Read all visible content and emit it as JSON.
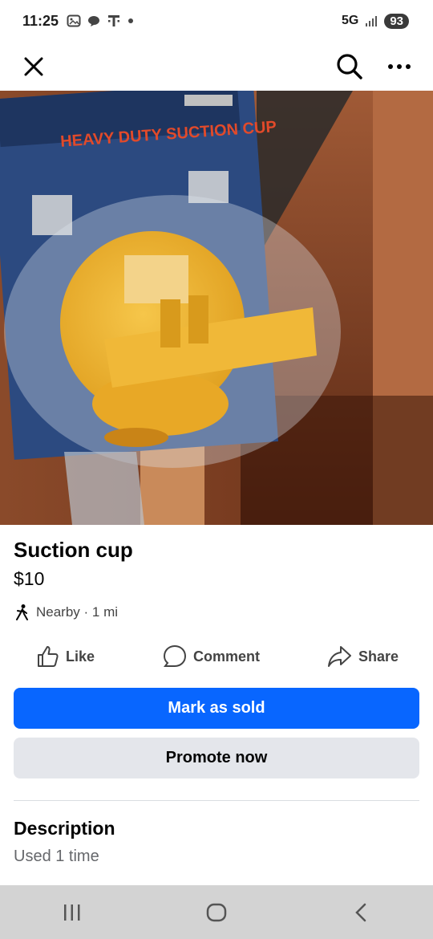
{
  "status_bar": {
    "time": "11:25",
    "notification_icons": [
      "screenshot-icon",
      "chat-icon",
      "t-mobile-icon",
      "dot-icon"
    ],
    "network": "5G",
    "battery": "93"
  },
  "top_bar": {
    "close_icon": "close-icon",
    "search_icon": "search-icon",
    "more_icon": "more-icon"
  },
  "listing": {
    "title": "Suction cup",
    "price": "$10",
    "location": "Nearby · 1 mi"
  },
  "actions": {
    "like": "Like",
    "comment": "Comment",
    "share": "Share"
  },
  "buttons": {
    "mark_sold": "Mark as sold",
    "promote": "Promote now"
  },
  "description": {
    "heading": "Description",
    "text": "Used 1 time"
  },
  "nav_bar": {
    "recents_icon": "recents-icon",
    "home_icon": "home-icon",
    "back_icon": "back-icon"
  },
  "colors": {
    "primary": "#0866ff",
    "secondary_button": "#e4e6eb",
    "nav_bar": "#d3d3d3"
  }
}
